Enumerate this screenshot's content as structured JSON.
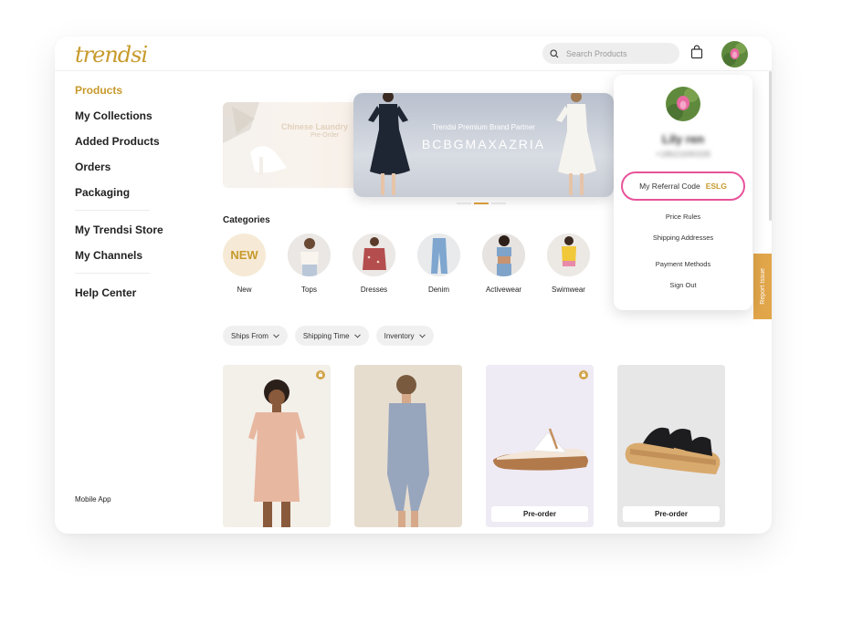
{
  "header": {
    "logo": "trendsi",
    "search_placeholder": "Search Products"
  },
  "sidebar": {
    "items": [
      {
        "label": "Products",
        "active": true
      },
      {
        "label": "My Collections"
      },
      {
        "label": "Added Products"
      },
      {
        "label": "Orders"
      },
      {
        "label": "Packaging"
      },
      {
        "label": "My Trendsi Store"
      },
      {
        "label": "My Channels"
      },
      {
        "label": "Help Center"
      }
    ],
    "mobile_app": "Mobile App"
  },
  "banner": {
    "left_title": "Chinese Laundry",
    "left_sub": "Pre-Order",
    "partner": "Trendsi Premium Brand Partner",
    "brand": "BCBGMAXAZRIA"
  },
  "categories": {
    "title": "Categories",
    "items": [
      "New",
      "Tops",
      "Dresses",
      "Denim",
      "Activewear",
      "Swimwear"
    ],
    "new_badge": "NEW"
  },
  "filters": [
    "Ships From",
    "Shipping Time",
    "Inventory"
  ],
  "products": [
    {
      "preorder": ""
    },
    {
      "preorder": ""
    },
    {
      "preorder": "Pre-order"
    },
    {
      "preorder": "Pre-order"
    }
  ],
  "popover": {
    "name": "Lily ren",
    "phone": "+18621690335",
    "referral_label": "My Referral Code",
    "referral_code": "ESLG",
    "links": [
      "Price Rules",
      "Shipping Addresses",
      "Payment Methods",
      "Sign Out"
    ]
  },
  "report_issue": "Report Issue",
  "colors": {
    "accent": "#c79a2c",
    "highlight": "#e8539a",
    "report_tab": "#e2a64a"
  }
}
